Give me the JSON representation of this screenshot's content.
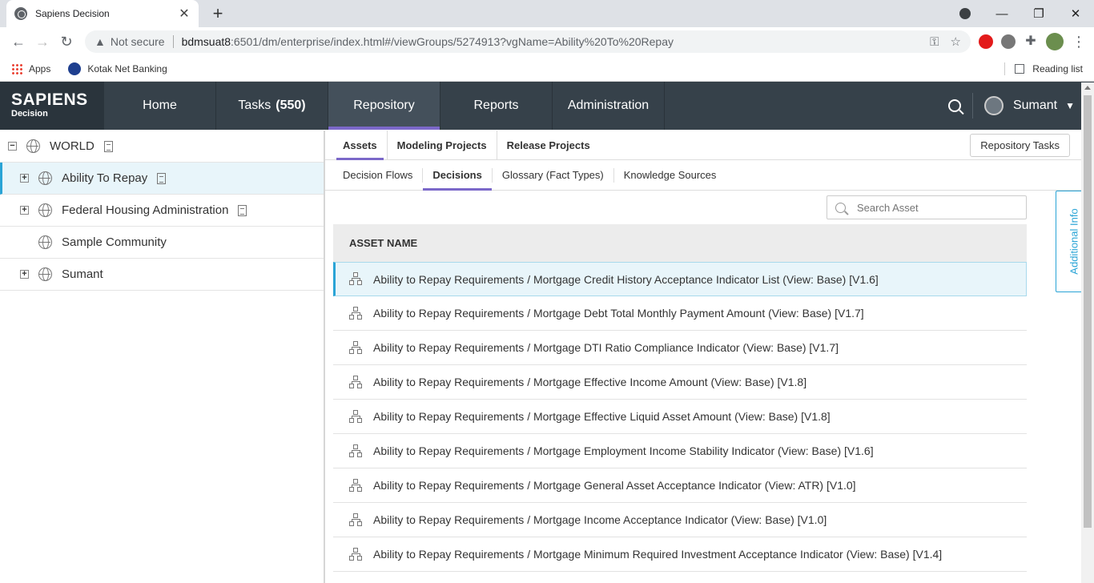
{
  "browser": {
    "tab_title": "Sapiens Decision",
    "new_tab": "+",
    "url_security": "Not secure",
    "url_host": "bdmsuat8",
    "url_path": ":6501/dm/enterprise/index.html#/viewGroups/5274913?vgName=Ability%20To%20Repay",
    "bookmarks": [
      "Apps",
      "Kotak Net Banking"
    ],
    "reading_list": "Reading list"
  },
  "header": {
    "logo_main": "SAPIENS",
    "logo_sub": "Decision",
    "nav": [
      {
        "label": "Home",
        "count": ""
      },
      {
        "label": "Tasks",
        "count": "(550)"
      },
      {
        "label": "Repository",
        "count": ""
      },
      {
        "label": "Reports",
        "count": ""
      },
      {
        "label": "Administration",
        "count": ""
      }
    ],
    "active_nav": "Repository",
    "user": "Sumant"
  },
  "tree": {
    "root": "WORLD",
    "children": [
      {
        "label": "Ability To Repay",
        "expandable": true,
        "doc": true,
        "selected": true
      },
      {
        "label": "Federal Housing Administration",
        "expandable": true,
        "doc": true,
        "selected": false
      },
      {
        "label": "Sample Community",
        "expandable": false,
        "doc": false,
        "selected": false
      },
      {
        "label": "Sumant",
        "expandable": true,
        "doc": false,
        "selected": false
      }
    ]
  },
  "tabs_primary": [
    "Assets",
    "Modeling Projects",
    "Release Projects"
  ],
  "tabs_secondary": [
    "Decision Flows",
    "Decisions",
    "Glossary (Fact Types)",
    "Knowledge Sources"
  ],
  "repository_tasks": "Repository Tasks",
  "search": {
    "placeholder": "Search Asset"
  },
  "grid": {
    "column": "ASSET NAME",
    "rows": [
      "Ability to Repay Requirements / Mortgage Credit History Acceptance Indicator List (View: Base) [V1.6]",
      "Ability to Repay Requirements / Mortgage Debt Total Monthly Payment Amount (View: Base) [V1.7]",
      "Ability to Repay Requirements / Mortgage DTI Ratio Compliance Indicator (View: Base) [V1.7]",
      "Ability to Repay Requirements / Mortgage Effective Income Amount (View: Base) [V1.8]",
      "Ability to Repay Requirements / Mortgage Effective Liquid Asset Amount (View: Base) [V1.8]",
      "Ability to Repay Requirements / Mortgage Employment Income Stability Indicator (View: Base) [V1.6]",
      "Ability to Repay Requirements / Mortgage General Asset Acceptance Indicator (View: ATR) [V1.0]",
      "Ability to Repay Requirements / Mortgage Income Acceptance Indicator (View: Base) [V1.0]",
      "Ability to Repay Requirements / Mortgage Minimum Required Investment Acceptance Indicator (View: Base) [V1.4]"
    ]
  },
  "additional_info": "Additional Info",
  "colors": {
    "accent": "#7b68c9",
    "header": "#36414a",
    "highlight": "#2aa4d6"
  }
}
